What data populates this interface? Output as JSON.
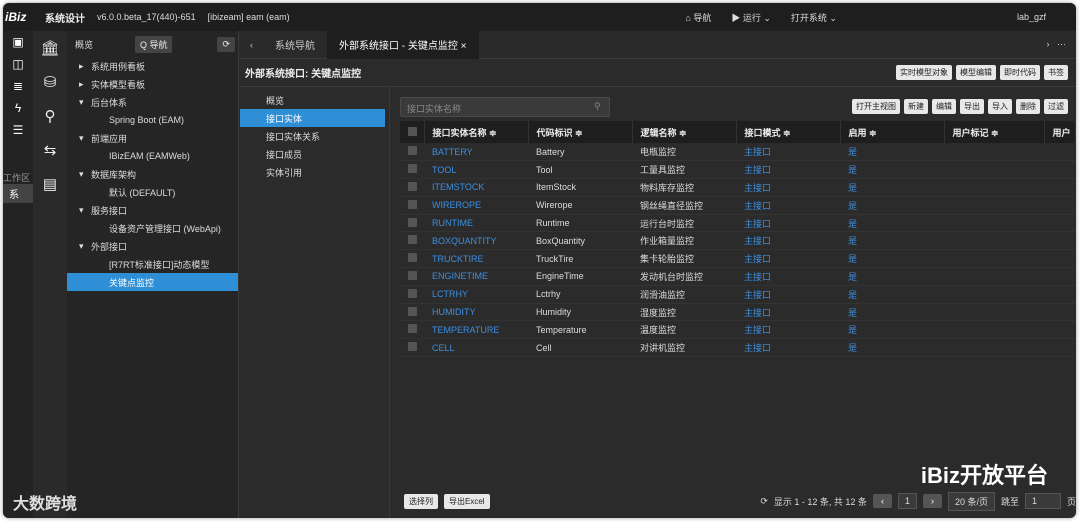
{
  "topbar": {
    "logo": "iBiz",
    "title": "系统设计",
    "version": "v6.0.0.beta_17(440)-651",
    "workspace": "[ibizeam] eam (eam)",
    "nav": "导航",
    "run": "运行",
    "open": "打开系统",
    "user": "lab_gzf"
  },
  "tree": {
    "header": "概览",
    "nav_btn": "Q 导航",
    "items": [
      {
        "label": "系统用例看板",
        "level": 1,
        "arrow": "▸"
      },
      {
        "label": "实体模型看板",
        "level": 1,
        "arrow": "▸"
      },
      {
        "label": "后台体系",
        "level": 1,
        "arrow": "▾"
      },
      {
        "label": "Spring Boot (EAM)",
        "level": 2,
        "arrow": ""
      },
      {
        "label": "前端应用",
        "level": 1,
        "arrow": "▾"
      },
      {
        "label": "IBizEAM (EAMWeb)",
        "level": 2,
        "arrow": ""
      },
      {
        "label": "数据库架构",
        "level": 1,
        "arrow": "▾"
      },
      {
        "label": "默认 (DEFAULT)",
        "level": 2,
        "arrow": ""
      },
      {
        "label": "服务接口",
        "level": 1,
        "arrow": "▾"
      },
      {
        "label": "设备资产管理接口 (WebApi)",
        "level": 2,
        "arrow": ""
      },
      {
        "label": "外部接口",
        "level": 1,
        "arrow": "▾"
      },
      {
        "label": "[R7RT标准接口]动态模型",
        "level": 2,
        "arrow": ""
      },
      {
        "label": "关键点监控",
        "level": 2,
        "arrow": "",
        "selected": true
      }
    ]
  },
  "rail": {
    "work": "工作区",
    "sys": "系"
  },
  "tabs": [
    {
      "label": "系统导航",
      "active": false
    },
    {
      "label": "外部系统接口 - 关键点监控 ×",
      "active": true
    }
  ],
  "page": {
    "title": "外部系统接口: 关键点监控",
    "buttons": [
      "实时模型对象",
      "模型编辑",
      "即时代码",
      "书签"
    ]
  },
  "subnav": [
    {
      "label": "概览"
    },
    {
      "label": "接口实体",
      "selected": true
    },
    {
      "label": "接口实体关系"
    },
    {
      "label": "接口成员"
    },
    {
      "label": "实体引用"
    }
  ],
  "grid": {
    "search_placeholder": "接口实体名称",
    "buttons": [
      "打开主视图",
      "新建",
      "编辑",
      "导出",
      "导入",
      "删除",
      "过滤"
    ],
    "columns": [
      "接口实体名称 ≑",
      "代码标识 ≑",
      "逻辑名称 ≑",
      "接口模式 ≑",
      "启用 ≑",
      "用户标记 ≑",
      "用户"
    ],
    "rows": [
      [
        "BATTERY",
        "Battery",
        "电瓶监控",
        "主接口",
        "是"
      ],
      [
        "TOOL",
        "Tool",
        "工量具监控",
        "主接口",
        "是"
      ],
      [
        "ITEMSTOCK",
        "ItemStock",
        "物料库存监控",
        "主接口",
        "是"
      ],
      [
        "WIREROPE",
        "Wirerope",
        "钢丝绳直径监控",
        "主接口",
        "是"
      ],
      [
        "RUNTIME",
        "Runtime",
        "运行台时监控",
        "主接口",
        "是"
      ],
      [
        "BOXQUANTITY",
        "BoxQuantity",
        "作业箱量监控",
        "主接口",
        "是"
      ],
      [
        "TRUCKTIRE",
        "TruckTire",
        "集卡轮胎监控",
        "主接口",
        "是"
      ],
      [
        "ENGINETIME",
        "EngineTime",
        "发动机台时监控",
        "主接口",
        "是"
      ],
      [
        "LCTRHY",
        "Lctrhy",
        "润滑油监控",
        "主接口",
        "是"
      ],
      [
        "HUMIDITY",
        "Humidity",
        "湿度监控",
        "主接口",
        "是"
      ],
      [
        "TEMPERATURE",
        "Temperature",
        "温度监控",
        "主接口",
        "是"
      ],
      [
        "CELL",
        "Cell",
        "对讲机监控",
        "主接口",
        "是"
      ]
    ],
    "footer": {
      "select_cols": "选择列",
      "export_excel": "导出Excel",
      "summary": "显示 1 - 12 条, 共 12 条",
      "page": "1",
      "page_size": "20 条/页",
      "goto": "跳至",
      "goto_value": "1",
      "page_unit": "页"
    }
  },
  "watermark": {
    "right": "iBiz开放平台",
    "left": "大数跨境"
  }
}
